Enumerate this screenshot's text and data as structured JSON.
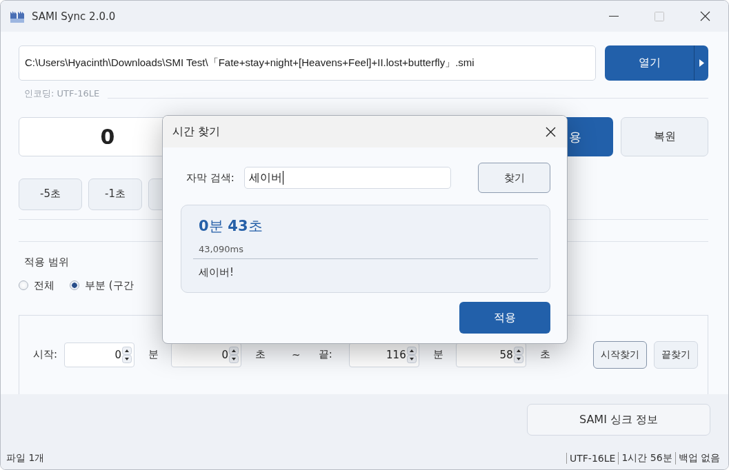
{
  "window": {
    "title": "SAMI Sync 2.0.0"
  },
  "file": {
    "path": "C:\\Users\\Hyacinth\\Downloads\\SMI Test\\「Fate+stay+night+[Heavens+Feel]+II.lost+butterfly」.smi",
    "open_button": "열기"
  },
  "encoding_label": "인코딩: UTF-16LE",
  "offset": {
    "value": "0",
    "apply_button": "용",
    "restore_button": "복원"
  },
  "step_buttons": [
    "-5초",
    "-1초"
  ],
  "range": {
    "title": "적용 범위",
    "options": [
      {
        "label": "전체",
        "selected": false
      },
      {
        "label": "부분 (구간",
        "selected": true
      }
    ]
  },
  "interval": {
    "items": [
      {
        "kind": "label",
        "text": "시작:"
      },
      {
        "kind": "spinner",
        "value": "0"
      },
      {
        "kind": "unit",
        "text": "분"
      },
      {
        "kind": "spinner",
        "value": "0"
      },
      {
        "kind": "unit",
        "text": "초"
      },
      {
        "kind": "unit",
        "text": "~"
      },
      {
        "kind": "label",
        "text": "끝:"
      },
      {
        "kind": "spinner",
        "value": "116"
      },
      {
        "kind": "unit",
        "text": "분"
      },
      {
        "kind": "spinner",
        "value": "58"
      },
      {
        "kind": "unit",
        "text": "초"
      }
    ],
    "buttons": [
      {
        "label": "시작찾기",
        "focused": true
      },
      {
        "label": "끝찾기",
        "focused": false
      }
    ]
  },
  "info_button": "SAMI 싱크 정보",
  "status_bar": {
    "left": "파일 1개",
    "items": [
      "UTF-16LE",
      "1시간 56분",
      "백업 없음"
    ]
  },
  "dialog": {
    "title": "시간 찾기",
    "search_label": "자막 검색:",
    "search_value": "세이버",
    "find_button": "찾기",
    "result": {
      "time": "**0**분 **43**초",
      "ms": "43,090ms",
      "text": "세이버!"
    },
    "apply_button": "적용"
  }
}
